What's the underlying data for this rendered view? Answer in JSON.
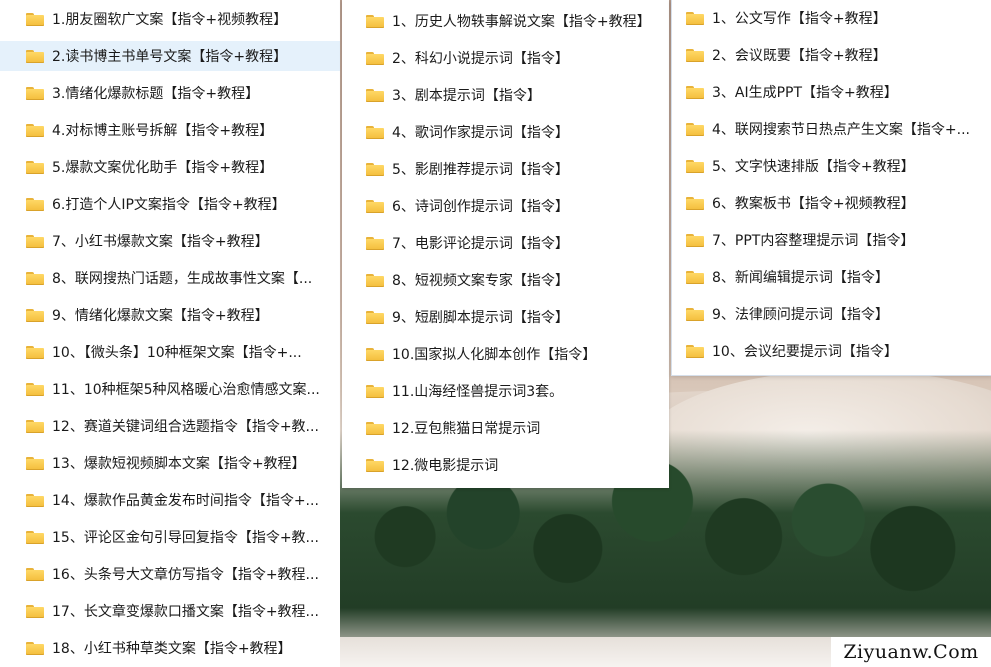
{
  "columns": [
    {
      "items": [
        "1.朋友圈软广文案【指令+视频教程】",
        "2.读书博主书单号文案【指令+教程】",
        "3.情绪化爆款标题【指令+教程】",
        "4.对标博主账号拆解【指令+教程】",
        "5.爆款文案优化助手【指令+教程】",
        "6.打造个人IP文案指令【指令+教程】",
        "7、小红书爆款文案【指令+教程】",
        "8、联网搜热门话题，生成故事性文案【...",
        "9、情绪化爆款文案【指令+教程】",
        "10、【微头条】10种框架文案【指令+...",
        "11、10种框架5种风格暖心治愈情感文案...",
        "12、赛道关键词组合选题指令【指令+教...",
        "13、爆款短视频脚本文案【指令+教程】",
        "14、爆款作品黄金发布时间指令【指令+...",
        "15、评论区金句引导回复指令【指令+教...",
        "16、头条号大文章仿写指令【指令+教程...",
        "17、长文章变爆款口播文案【指令+教程...",
        "18、小红书种草类文案【指令+教程】"
      ],
      "selected_index": 1
    },
    {
      "items": [
        "1、历史人物轶事解说文案【指令+教程】",
        "2、科幻小说提示词【指令】",
        "3、剧本提示词【指令】",
        "4、歌词作家提示词【指令】",
        "5、影剧推荐提示词【指令】",
        "6、诗词创作提示词【指令】",
        "7、电影评论提示词【指令】",
        "8、短视频文案专家【指令】",
        "9、短剧脚本提示词【指令】",
        "10.国家拟人化脚本创作【指令】",
        "11.山海经怪兽提示词3套。",
        "12.豆包熊猫日常提示词",
        "12.微电影提示词"
      ]
    },
    {
      "items": [
        "1、公文写作【指令+教程】",
        "2、会议既要【指令+教程】",
        "3、AI生成PPT【指令+教程】",
        "4、联网搜索节日热点产生文案【指令+...",
        "5、文字快速排版【指令+教程】",
        "6、教案板书【指令+视频教程】",
        "7、PPT内容整理提示词【指令】",
        "8、新闻编辑提示词【指令】",
        "9、法律顾问提示词【指令】",
        "10、会议纪要提示词【指令】"
      ]
    }
  ],
  "watermark": "Ziyuanw.Com",
  "colors": {
    "selection": "#e5f1fb",
    "folder": "#f3bd3b"
  }
}
